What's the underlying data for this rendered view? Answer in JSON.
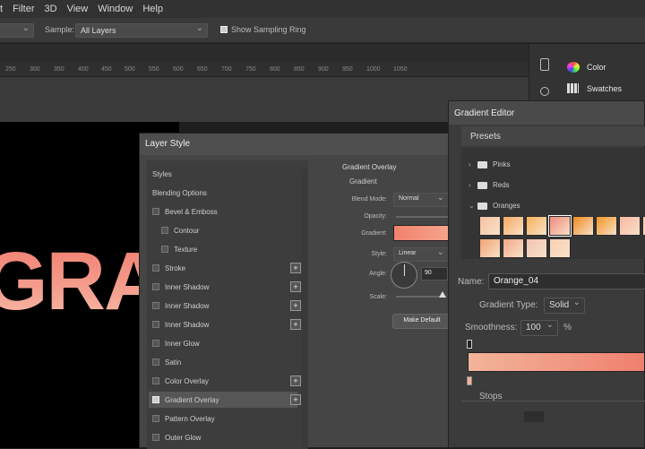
{
  "menubar": {
    "items": [
      "t",
      "Filter",
      "3D",
      "View",
      "Window",
      "Help"
    ]
  },
  "optionsbar": {
    "sample_label": "Sample:",
    "sample_value": "All Layers",
    "show_ring": "Show Sampling Ring"
  },
  "ruler": {
    "ticks": [
      "250",
      "300",
      "350",
      "400",
      "450",
      "500",
      "550",
      "600",
      "650",
      "700",
      "750",
      "800",
      "850",
      "900",
      "950",
      "1000",
      "1050"
    ]
  },
  "panels": {
    "color": "Color",
    "swatches": "Swatches"
  },
  "canvas": {
    "text": "GRA"
  },
  "layer_style": {
    "title": "Layer Style",
    "items": [
      "Styles",
      "Blending Options",
      "Bevel & Emboss",
      "Contour",
      "Texture",
      "Stroke",
      "Inner Shadow",
      "Inner Shadow",
      "Inner Shadow",
      "Inner Glow",
      "Satin",
      "Color Overlay",
      "Gradient Overlay",
      "Pattern Overlay",
      "Outer Glow"
    ],
    "section_title": "Gradient Overlay",
    "section_sub": "Gradient",
    "blend_mode_label": "Blend Mode:",
    "blend_mode_value": "Normal",
    "opacity_label": "Opacity:",
    "gradient_label": "Gradient:",
    "style_label": "Style:",
    "style_value": "Linear",
    "angle_label": "Angle:",
    "angle_value": "90",
    "scale_label": "Scale:",
    "make_default": "Make Default"
  },
  "gradient_editor": {
    "title": "Gradient Editor",
    "presets_label": "Presets",
    "folders": [
      "Pinks",
      "Reds",
      "Oranges"
    ],
    "swatch_colors": [
      "#f6c3a0",
      "#f5a95f",
      "#f6b258",
      "#f08a7e",
      "#f0891c",
      "#f39525",
      "#f8b9a3",
      "#f4cbb0",
      "#f1a472",
      "#f3a686",
      "#f2c4b2",
      "#f7d1b5"
    ],
    "name_label": "Name:",
    "name_value": "Orange_04",
    "gradient_type_label": "Gradient Type:",
    "gradient_type_value": "Solid",
    "smoothness_label": "Smoothness:",
    "smoothness_value": "100",
    "smoothness_unit": "%",
    "stops_label": "Stops"
  }
}
